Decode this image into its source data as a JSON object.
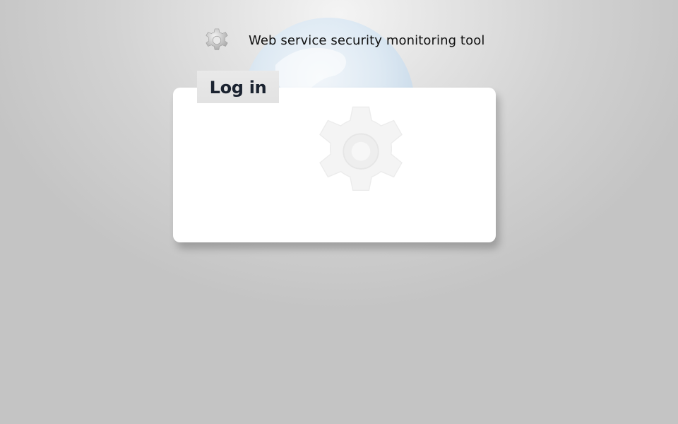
{
  "header": {
    "logo_icon": "gear-icon",
    "title": "Web service security monitoring tool"
  },
  "background": {
    "decor_icon": "globe-icon"
  },
  "login": {
    "heading": "Log in",
    "watermark_icon": "gear-icon"
  },
  "colors": {
    "card_background": "#ffffff",
    "tab_background": "#e6e6e6",
    "page_background": "#c4c4c4",
    "text": "#111111"
  }
}
